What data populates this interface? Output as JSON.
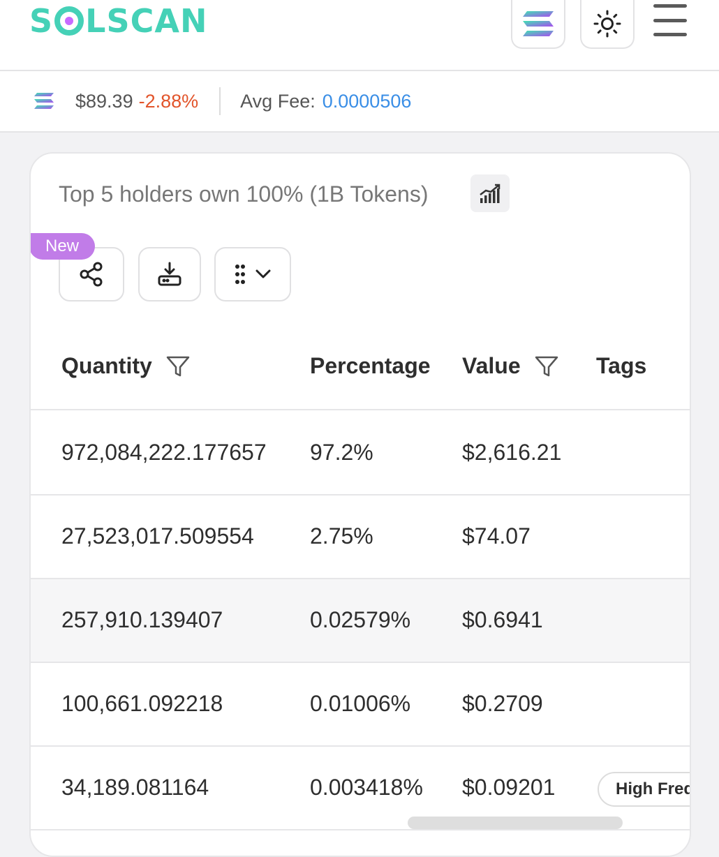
{
  "header": {
    "logo_text_pre": "S",
    "logo_text_post": "LSCAN",
    "icons": {
      "sol": "solana-icon",
      "theme": "sun-icon",
      "menu": "hamburger-menu-icon"
    }
  },
  "pricebar": {
    "price": "$89.39",
    "change": "-2.88%",
    "fee_label": "Avg Fee:",
    "fee_value": "0.0000506"
  },
  "holders": {
    "summary": "Top 5 holders own 100% (1B Tokens)",
    "new_badge": "New",
    "columns": {
      "quantity": "Quantity",
      "percentage": "Percentage",
      "value": "Value",
      "tags": "Tags"
    },
    "rows": [
      {
        "quantity": "972,084,222.177657",
        "percentage": "97.2%",
        "value": "$2,616.21",
        "tag": ""
      },
      {
        "quantity": "27,523,017.509554",
        "percentage": "2.75%",
        "value": "$74.07",
        "tag": ""
      },
      {
        "quantity": "257,910.139407",
        "percentage": "0.02579%",
        "value": "$0.6941",
        "tag": ""
      },
      {
        "quantity": "100,661.092218",
        "percentage": "0.01006%",
        "value": "$0.2709",
        "tag": ""
      },
      {
        "quantity": "34,189.081164",
        "percentage": "0.003418%",
        "value": "$0.09201",
        "tag": "High Freq"
      }
    ]
  },
  "colors": {
    "brand": "#45d1b7",
    "logo_dot": "#c76bff",
    "negative": "#e2542a",
    "link": "#3a8ee6",
    "badge": "#c17ce8"
  }
}
